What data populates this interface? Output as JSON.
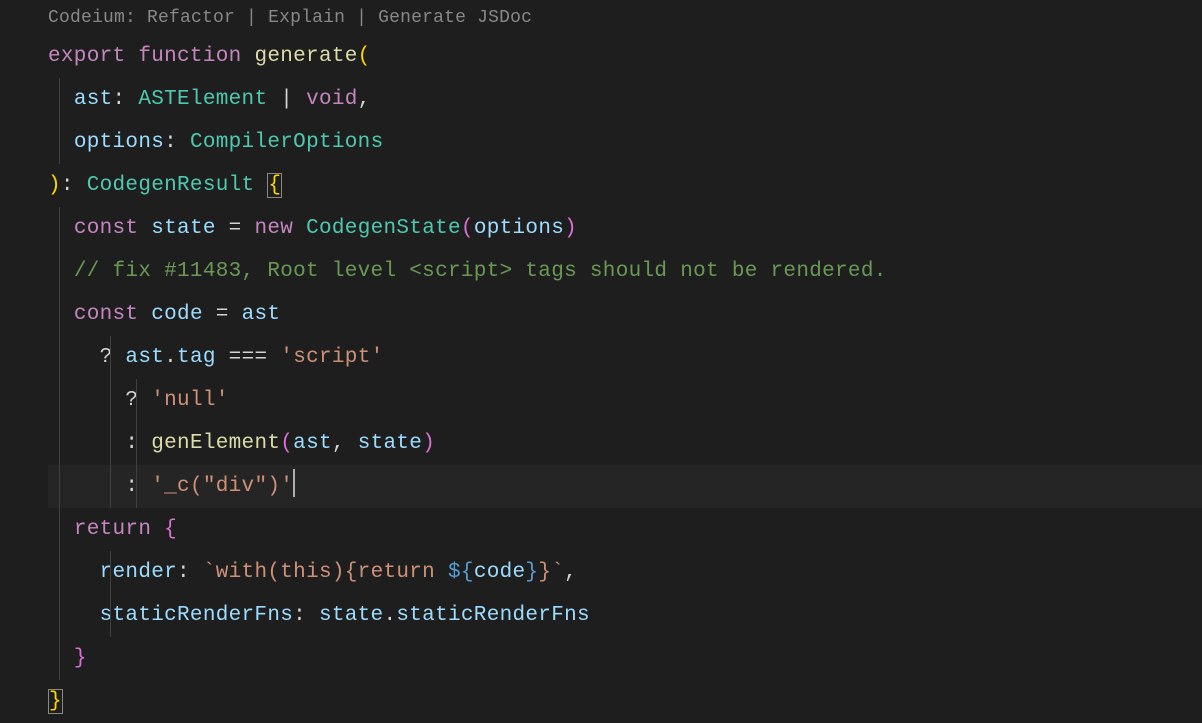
{
  "codelens": {
    "provider": "Codeium:",
    "actions": [
      "Refactor",
      "Explain",
      "Generate JSDoc"
    ],
    "separator": " | "
  },
  "code": {
    "l1": {
      "export": "export",
      "function": "function",
      "name": "generate",
      "paren_open": "("
    },
    "l2": {
      "param": "ast",
      "colon": ":",
      "type": "ASTElement",
      "pipe": "|",
      "void": "void",
      "comma": ","
    },
    "l3": {
      "param": "options",
      "colon": ":",
      "type": "CompilerOptions"
    },
    "l4": {
      "paren_close": ")",
      "colon": ":",
      "rettype": "CodegenResult",
      "brace_open": "{"
    },
    "l5": {
      "const": "const",
      "name": "state",
      "eq": "=",
      "new": "new",
      "ctor": "CodegenState",
      "popen": "(",
      "arg": "options",
      "pclose": ")"
    },
    "l6": {
      "comment": "// fix #11483, Root level <script> tags should not be rendered."
    },
    "l7": {
      "const": "const",
      "name": "code",
      "eq": "=",
      "rhs": "ast"
    },
    "l8": {
      "qmark": "?",
      "obj": "ast",
      "dot": ".",
      "prop": "tag",
      "op": "===",
      "str": "'script'"
    },
    "l9": {
      "qmark": "?",
      "str": "'null'"
    },
    "l10": {
      "colon": ":",
      "fn": "genElement",
      "popen": "(",
      "a1": "ast",
      "comma": ",",
      "a2": "state",
      "pclose": ")"
    },
    "l11": {
      "colon": ":",
      "str": "'_c(\"div\")'"
    },
    "l12": {
      "return": "return",
      "brace_open": "{"
    },
    "l13": {
      "prop": "render",
      "colon": ":",
      "tpl_open": "`",
      "tpl_text1": "with(this){return ",
      "interp_open": "${",
      "interp_var": "code",
      "interp_close": "}",
      "tpl_text2": "}",
      "tpl_close": "`",
      "comma": ","
    },
    "l14": {
      "prop": "staticRenderFns",
      "colon": ":",
      "obj": "state",
      "dot": ".",
      "prop2": "staticRenderFns"
    },
    "l15": {
      "brace_close": "}"
    },
    "l16": {
      "brace_close": "}"
    }
  }
}
